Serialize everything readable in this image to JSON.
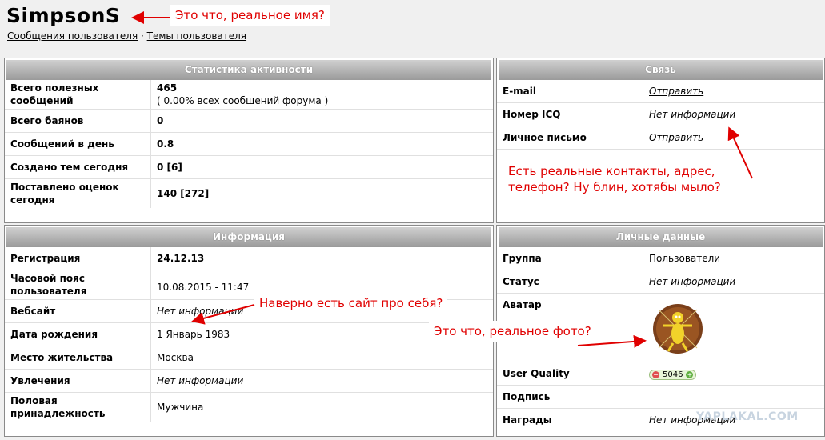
{
  "user": {
    "name": "SimpsonS"
  },
  "links": {
    "posts": "Сообщения пользователя",
    "separator": " · ",
    "topics": "Темы пользователя"
  },
  "stats": {
    "heading": "Статистика активности",
    "rows": [
      {
        "label": "Всего полезных сообщений",
        "value": "465",
        "sub": "( 0.00% всех сообщений форума )"
      },
      {
        "label": "Всего баянов",
        "value": "0"
      },
      {
        "label": "Сообщений в день",
        "value": "0.8"
      },
      {
        "label": "Создано тем сегодня",
        "value": "0 [6]"
      },
      {
        "label": "Поставлено оценок сегодня",
        "value": "140 [272]"
      }
    ]
  },
  "contact": {
    "heading": "Связь",
    "rows": [
      {
        "label": "E-mail",
        "value": "Отправить"
      },
      {
        "label": "Номер ICQ",
        "value": "Нет информации"
      },
      {
        "label": "Личное письмо",
        "value": "Отправить"
      }
    ]
  },
  "info": {
    "heading": "Информация",
    "rows": [
      {
        "label": "Регистрация",
        "value": "24.12.13"
      },
      {
        "label": "Часовой пояс пользователя",
        "value": "10.08.2015 - 11:47"
      },
      {
        "label": "Вебсайт",
        "value": "Нет информации"
      },
      {
        "label": "Дата рождения",
        "value": "1 Январь 1983"
      },
      {
        "label": "Место жительства",
        "value": "Москва"
      },
      {
        "label": "Увлечения",
        "value": "Нет информации"
      },
      {
        "label": "Половая принадлежность",
        "value": "Мужчина"
      }
    ]
  },
  "personal": {
    "heading": "Личные данные",
    "rows": [
      {
        "label": "Группа",
        "value": "Пользователи"
      },
      {
        "label": "Статус",
        "value": "Нет информации"
      },
      {
        "label": "Аватар",
        "value": ""
      },
      {
        "label": "User Quality",
        "value": "5046"
      },
      {
        "label": "Подпись",
        "value": ""
      },
      {
        "label": "Награды",
        "value": "Нет информации"
      }
    ]
  },
  "annotations": {
    "name": "Это что, реальное имя?",
    "contacts": "Есть реальные контакты, адрес, телефон? Ну блин, хотябы мыло?",
    "site": "Наверно есть сайт про себя?",
    "photo": "Это что, реальное фото?"
  },
  "watermark": "YAPLAKAL.COM",
  "colors": {
    "annotation": "#e00000",
    "header": "#a8a8a8",
    "quality_minus": "#e05050",
    "quality_plus": "#60b040"
  }
}
